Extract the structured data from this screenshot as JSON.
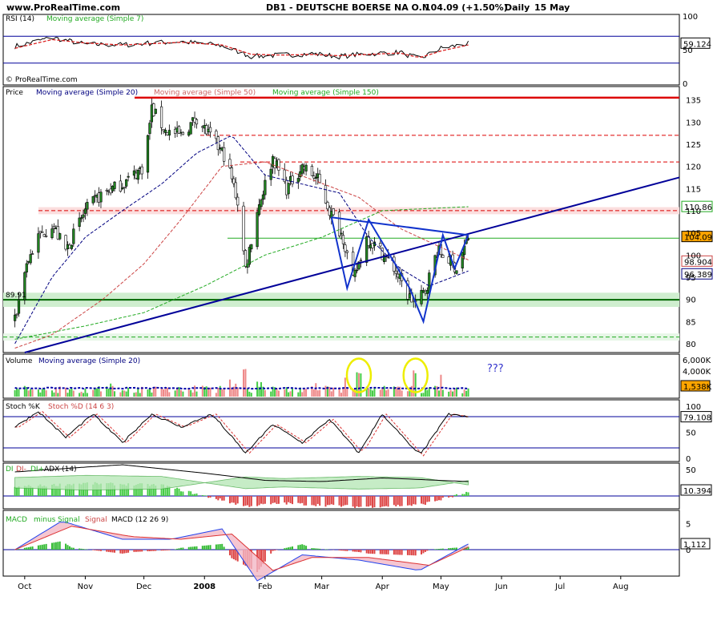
{
  "header": {
    "site": "www.ProRealTime.com",
    "instrument": "DB1 - DEUTSCHE BOERSE NA O.N",
    "quote": "104.09 (+1.50%)",
    "period": "Daily",
    "date": "15 May"
  },
  "watermark": "© ProRealTime.com",
  "colors": {
    "ma20": "#000080",
    "ma50": "#cc4444",
    "ma150": "#22aa22",
    "up_candle": "#228822",
    "down_candle": "#ffffff",
    "trendline": "#000099",
    "pattern": "#1133cc",
    "highlight_circle": "#eeee00",
    "last_price_bg": "#ffa500"
  },
  "chart_data": [
    {
      "panel": "rsi",
      "type": "line",
      "labels": [
        "RSI (14)",
        "Moving average (Simple 7)"
      ],
      "ylim": [
        0,
        100
      ],
      "yticks": [
        "100",
        "50",
        "0"
      ],
      "levels": [
        70,
        30
      ],
      "last_value": "59.124",
      "series": [
        {
          "name": "RSI (14)",
          "x": [
            "2007-09-26",
            "2007-10-15",
            "2007-11-01",
            "2007-11-20",
            "2007-12-05",
            "2007-12-20",
            "2008-01-10",
            "2008-01-25",
            "2008-02-10",
            "2008-02-25",
            "2008-03-10",
            "2008-03-25",
            "2008-04-10",
            "2008-04-20",
            "2008-05-01",
            "2008-05-15"
          ],
          "values": [
            55,
            68,
            58,
            57,
            60,
            62,
            56,
            40,
            42,
            44,
            40,
            44,
            46,
            36,
            52,
            59
          ]
        },
        {
          "name": "Moving average (Simple 7)",
          "x": [
            "2007-09-26",
            "2007-10-15",
            "2007-11-01",
            "2007-11-20",
            "2007-12-05",
            "2007-12-20",
            "2008-01-10",
            "2008-01-25",
            "2008-02-10",
            "2008-02-25",
            "2008-03-10",
            "2008-03-25",
            "2008-04-10",
            "2008-04-20",
            "2008-05-01",
            "2008-05-15"
          ],
          "values": [
            52,
            65,
            60,
            57,
            59,
            61,
            57,
            43,
            42,
            43,
            41,
            43,
            45,
            38,
            48,
            57
          ]
        }
      ]
    },
    {
      "panel": "price",
      "type": "candlestick",
      "labels": [
        "Price",
        "Moving average (Simple 20)",
        "Moving average (Simple 50)",
        "Moving average (Simple 150)"
      ],
      "ylim": [
        78,
        138
      ],
      "yticks": [
        "135",
        "130",
        "125",
        "120",
        "115",
        "110",
        "105",
        "100",
        "95",
        "90",
        "85",
        "80"
      ],
      "price_labels": [
        "110.86",
        "104.09",
        "98.904",
        "96.389",
        "89.91"
      ],
      "close_series": {
        "x": [
          "2007-09-26",
          "2007-10-01",
          "2007-10-08",
          "2007-10-15",
          "2007-10-22",
          "2007-11-01",
          "2007-11-10",
          "2007-11-20",
          "2007-12-01",
          "2007-12-05",
          "2007-12-12",
          "2007-12-20",
          "2007-12-28",
          "2008-01-05",
          "2008-01-12",
          "2008-01-18",
          "2008-01-22",
          "2008-01-28",
          "2008-02-05",
          "2008-02-12",
          "2008-02-20",
          "2008-02-28",
          "2008-03-05",
          "2008-03-12",
          "2008-03-17",
          "2008-03-24",
          "2008-03-31",
          "2008-04-07",
          "2008-04-14",
          "2008-04-18",
          "2008-04-23",
          "2008-04-29",
          "2008-05-05",
          "2008-05-09",
          "2008-05-15"
        ],
        "values": [
          85,
          97,
          104,
          107,
          101,
          110,
          114,
          116,
          120,
          133,
          128,
          127,
          131,
          126,
          122,
          112,
          97,
          110,
          122,
          115,
          120,
          117,
          110,
          104,
          94,
          104,
          101,
          97,
          91,
          89,
          92,
          101,
          99,
          97,
          104
        ]
      },
      "moving_averages": [
        {
          "name": "Moving average (Simple 20)",
          "x": [
            "2007-09-26",
            "2007-10-15",
            "2007-11-01",
            "2007-11-20",
            "2007-12-10",
            "2007-12-28",
            "2008-01-15",
            "2008-02-01",
            "2008-02-20",
            "2008-03-10",
            "2008-03-25",
            "2008-04-10",
            "2008-04-25",
            "2008-05-15"
          ],
          "values": [
            80,
            95,
            104,
            110,
            116,
            123,
            127,
            118,
            116,
            114,
            104,
            97,
            93,
            96.4
          ]
        },
        {
          "name": "Moving average (Simple 50)",
          "x": [
            "2007-09-26",
            "2007-10-15",
            "2007-11-10",
            "2007-12-01",
            "2007-12-20",
            "2008-01-10",
            "2008-02-01",
            "2008-02-25",
            "2008-03-20",
            "2008-04-10",
            "2008-05-15"
          ],
          "values": [
            79,
            82,
            90,
            98,
            108,
            120,
            121,
            117,
            113,
            106,
            98.9
          ]
        },
        {
          "name": "Moving average (Simple 150)",
          "x": [
            "2007-09-26",
            "2007-11-01",
            "2007-12-01",
            "2008-01-01",
            "2008-02-01",
            "2008-03-01",
            "2008-04-01",
            "2008-05-15"
          ],
          "values": [
            81,
            84,
            87,
            93,
            100,
            104,
            110,
            110.9
          ]
        }
      ],
      "horizontal_lines": [
        {
          "y": 135.5,
          "color": "#dd0000",
          "style": "solid"
        },
        {
          "y": 127,
          "color": "#dd0000",
          "style": "dashed"
        },
        {
          "y": 121,
          "color": "#dd0000",
          "style": "dashed"
        },
        {
          "y": 110,
          "color": "#dd0000",
          "style": "dashed"
        },
        {
          "y": 103.8,
          "color": "#22aa22",
          "style": "solid"
        },
        {
          "y": 89.9,
          "color": "#006600",
          "style": "solid"
        },
        {
          "y": 81.5,
          "color": "#22aa22",
          "style": "dashed"
        }
      ],
      "trendline": {
        "x": [
          "2007-10-01",
          "2008-08-31"
        ],
        "y": [
          78,
          117.5
        ]
      },
      "pattern_points": {
        "x": [
          "2008-03-06",
          "2008-03-14",
          "2008-03-25",
          "2008-04-15",
          "2008-04-22",
          "2008-05-02",
          "2008-05-08",
          "2008-05-15"
        ],
        "y": [
          108.5,
          92.5,
          108,
          92.5,
          85,
          104.5,
          97,
          104.5
        ]
      },
      "neckline": {
        "x": [
          "2008-03-06",
          "2008-05-15"
        ],
        "y": [
          108.5,
          104.5
        ]
      }
    },
    {
      "panel": "volume",
      "type": "bar",
      "labels": [
        "Volume",
        "Moving average (Simple 20)"
      ],
      "yticks": [
        "6,000K",
        "4,000K"
      ],
      "last_value": "1,538K",
      "annotation": "???",
      "ylim": [
        0,
        7000
      ],
      "average": 1500,
      "peaks": [
        {
          "x": "2008-01-21",
          "value": 6000
        },
        {
          "x": "2008-03-20",
          "value": 4500
        },
        {
          "x": "2008-04-18",
          "value": 4800
        }
      ]
    },
    {
      "panel": "stochastic",
      "type": "line",
      "labels": [
        "Stoch %K",
        "Stoch %D (14 6 3)"
      ],
      "ylim": [
        0,
        100
      ],
      "yticks": [
        "100",
        "50",
        "0"
      ],
      "levels": [
        80,
        20
      ],
      "last_value": "79.108",
      "series": [
        {
          "name": "Stoch %K",
          "x": [
            "2007-09-26",
            "2007-10-08",
            "2007-10-22",
            "2007-11-05",
            "2007-11-20",
            "2007-12-05",
            "2007-12-20",
            "2008-01-05",
            "2008-01-22",
            "2008-02-05",
            "2008-02-20",
            "2008-03-05",
            "2008-03-20",
            "2008-04-01",
            "2008-04-20",
            "2008-05-05",
            "2008-05-15"
          ],
          "values": [
            60,
            90,
            40,
            85,
            30,
            85,
            60,
            85,
            10,
            65,
            30,
            75,
            10,
            85,
            5,
            85,
            79
          ]
        }
      ]
    },
    {
      "panel": "dmi",
      "type": "area",
      "labels": [
        "DI",
        "DI-",
        "DI+",
        "ADX (14)"
      ],
      "yticks": [
        "50"
      ],
      "last_value": "10.394",
      "series": [
        {
          "name": "ADX (14)",
          "x": [
            "2007-09-26",
            "2007-11-01",
            "2007-11-20",
            "2008-01-01",
            "2008-02-01",
            "2008-03-01",
            "2008-04-01",
            "2008-05-15"
          ],
          "values": [
            40,
            48,
            52,
            38,
            26,
            24,
            30,
            24
          ]
        },
        {
          "name": "DI",
          "x": [
            "2007-09-26",
            "2007-11-01",
            "2007-12-10",
            "2008-01-22",
            "2008-02-10",
            "2008-03-20",
            "2008-04-20",
            "2008-05-15"
          ],
          "values": [
            25,
            35,
            30,
            -28,
            -20,
            -30,
            -25,
            10
          ]
        }
      ]
    },
    {
      "panel": "macd",
      "type": "bar",
      "labels": [
        "MACD",
        "minus",
        "Signal",
        "Signal",
        "MACD (12 26 9)"
      ],
      "yticks": [
        "5",
        "0"
      ],
      "last_value": "1.112",
      "series": [
        {
          "name": "MACD",
          "x": [
            "2007-09-26",
            "2007-10-20",
            "2007-11-20",
            "2007-12-15",
            "2008-01-10",
            "2008-01-28",
            "2008-02-20",
            "2008-03-20",
            "2008-04-20",
            "2008-05-15"
          ],
          "values": [
            0,
            5.5,
            2,
            2,
            4,
            -6,
            -1,
            -2,
            -4,
            1.1
          ]
        },
        {
          "name": "Signal",
          "x": [
            "2007-09-26",
            "2007-10-25",
            "2007-11-25",
            "2007-12-20",
            "2008-01-15",
            "2008-02-05",
            "2008-02-25",
            "2008-03-25",
            "2008-04-25",
            "2008-05-15"
          ],
          "values": [
            0,
            4.5,
            2.5,
            2,
            3,
            -4,
            -1.5,
            -1.5,
            -3,
            0.5
          ]
        }
      ]
    },
    {
      "panel": "x-axis",
      "type": "axis",
      "xticks": [
        {
          "label": "Oct",
          "date": "2007-10-01"
        },
        {
          "label": "Nov",
          "date": "2007-11-01"
        },
        {
          "label": "Dec",
          "date": "2007-12-01"
        },
        {
          "label": "2008",
          "date": "2008-01-01"
        },
        {
          "label": "Feb",
          "date": "2008-02-01"
        },
        {
          "label": "Mar",
          "date": "2008-03-01"
        },
        {
          "label": "Apr",
          "date": "2008-04-01"
        },
        {
          "label": "May",
          "date": "2008-05-01"
        },
        {
          "label": "Jun",
          "date": "2008-06-01"
        },
        {
          "label": "Jul",
          "date": "2008-07-01"
        },
        {
          "label": "Aug",
          "date": "2008-08-01"
        }
      ],
      "xlim": [
        "2007-09-20",
        "2008-08-31"
      ]
    }
  ]
}
